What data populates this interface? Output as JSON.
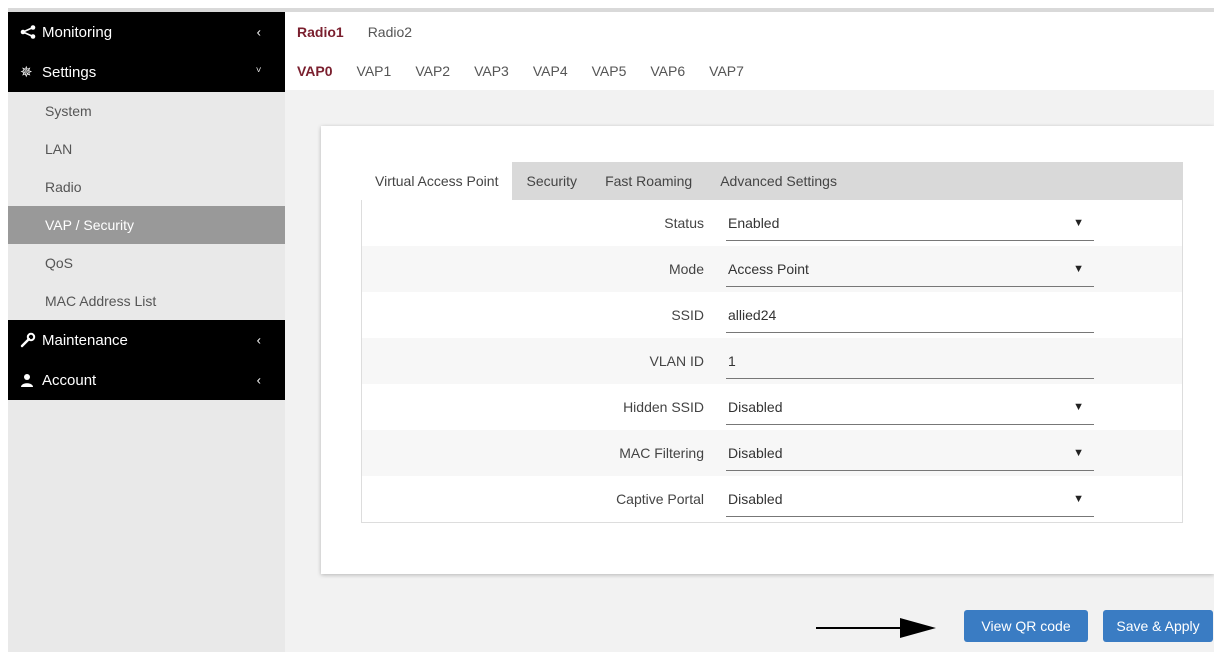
{
  "sidebar": {
    "monitoring": {
      "label": "Monitoring",
      "icon": "share-icon"
    },
    "settings": {
      "label": "Settings",
      "icon": "gear-icon"
    },
    "settings_items": [
      {
        "label": "System"
      },
      {
        "label": "LAN"
      },
      {
        "label": "Radio"
      },
      {
        "label": "VAP / Security",
        "active": true
      },
      {
        "label": "QoS"
      },
      {
        "label": "MAC Address List"
      }
    ],
    "maintenance": {
      "label": "Maintenance",
      "icon": "wrench-icon"
    },
    "account": {
      "label": "Account",
      "icon": "user-icon"
    }
  },
  "radio_tabs": [
    "Radio1",
    "Radio2"
  ],
  "vap_tabs": [
    "VAP0",
    "VAP1",
    "VAP2",
    "VAP3",
    "VAP4",
    "VAP5",
    "VAP6",
    "VAP7"
  ],
  "inner_tabs": [
    "Virtual Access Point",
    "Security",
    "Fast Roaming",
    "Advanced Settings"
  ],
  "form": {
    "status": {
      "label": "Status",
      "value": "Enabled"
    },
    "mode": {
      "label": "Mode",
      "value": "Access Point"
    },
    "ssid": {
      "label": "SSID",
      "value": "allied24"
    },
    "vlan": {
      "label": "VLAN ID",
      "value": "1"
    },
    "hidden_ssid": {
      "label": "Hidden SSID",
      "value": "Disabled"
    },
    "mac_filtering": {
      "label": "MAC Filtering",
      "value": "Disabled"
    },
    "captive_portal": {
      "label": "Captive Portal",
      "value": "Disabled"
    }
  },
  "buttons": {
    "qr": "View QR code",
    "save": "Save & Apply"
  },
  "colors": {
    "accent": "#7a1f2e",
    "button": "#3a7cc3",
    "active_side": "#999999"
  }
}
